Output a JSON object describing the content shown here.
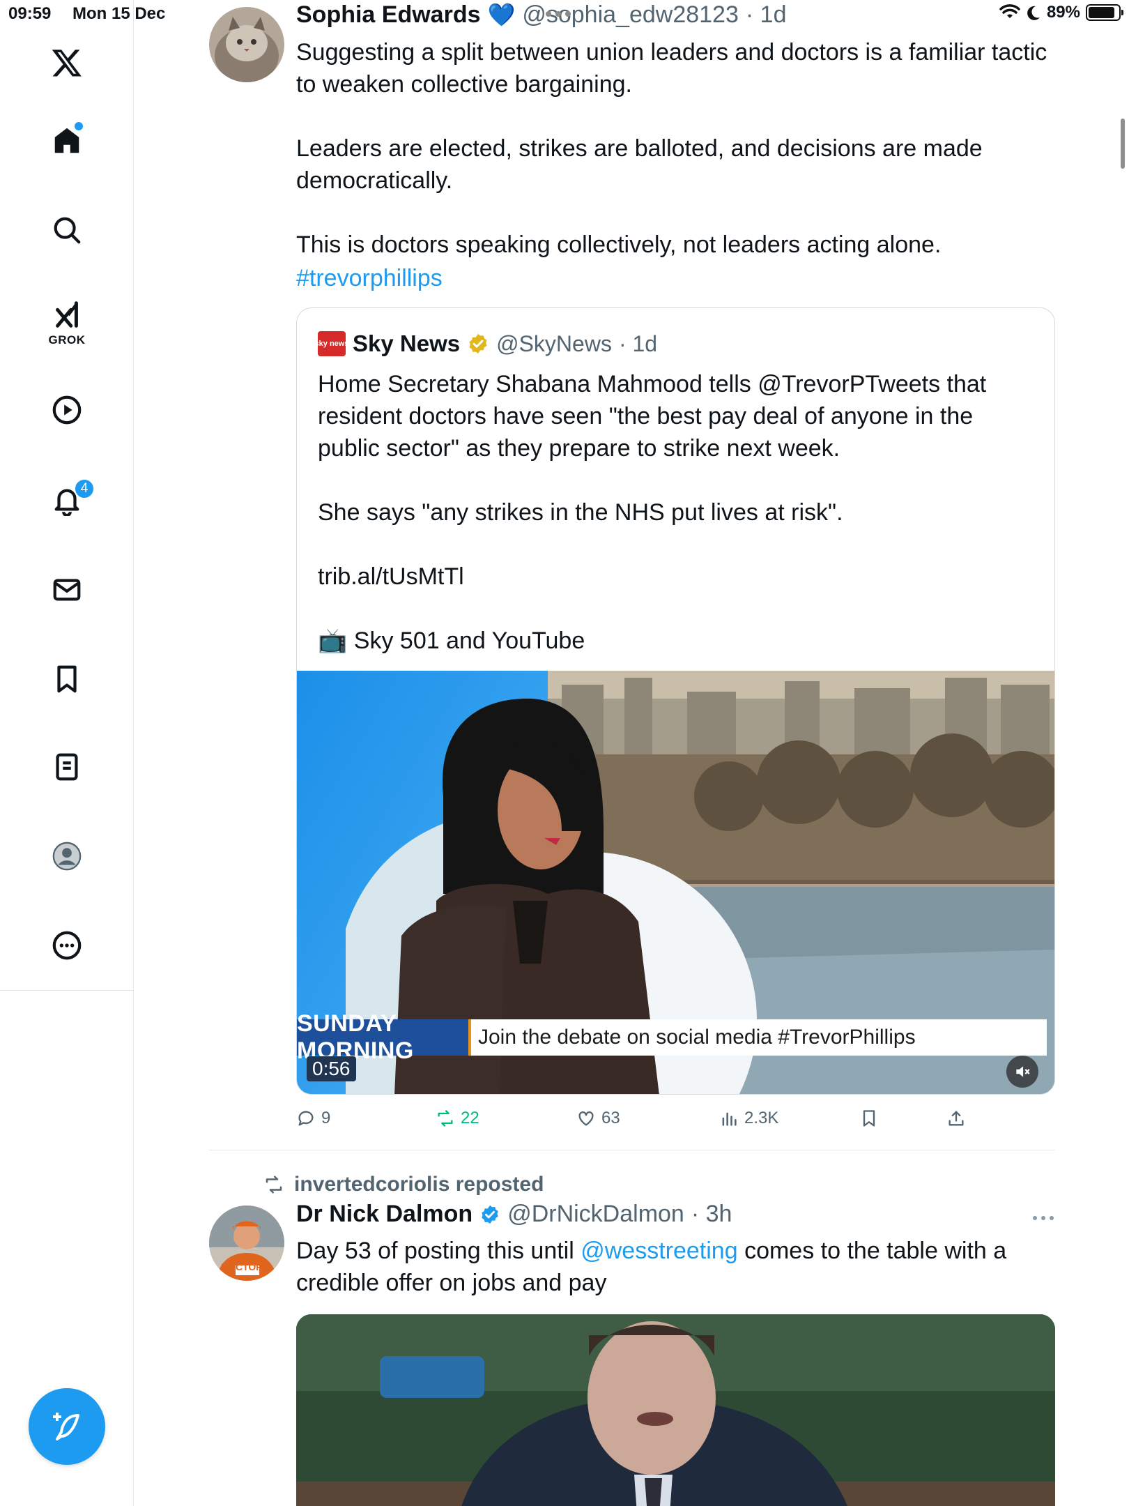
{
  "status_bar": {
    "time": "09:59",
    "date": "Mon 15 Dec",
    "battery": "89%",
    "battery_level": 0.89
  },
  "sidebar": {
    "grok_label": "GROK",
    "notification_count": "4"
  },
  "tweet1": {
    "name": "Sophia Edwards",
    "emoji": "💙",
    "handle": "@sophia_edw28123",
    "time": "· 1d",
    "text": "Suggesting a split between union leaders and doctors is a familiar tactic\nto weaken collective bargaining.\n\nLeaders are elected, strikes are balloted, and decisions are made\ndemocratically.\n\nThis is doctors speaking collectively, not leaders acting alone.",
    "hashtag": "#trevorphillips",
    "quote": {
      "logo_text": "sky news",
      "name": "Sky News",
      "handle": "@SkyNews",
      "time": "· 1d",
      "text": "Home Secretary Shabana Mahmood tells @TrevorPTweets that\nresident doctors have seen \"the best pay deal of anyone in the\npublic sector\" as they prepare to strike next week.\n\nShe says \"any strikes in the NHS put lives at risk\".\n\ntrib.al/tUsMtTl\n\n📺 Sky 501 and YouTube",
      "video": {
        "programme": "SUNDAY MORNING",
        "ticker": "Join the debate on social media #TrevorPhillips",
        "duration": "0:56"
      }
    },
    "actions": {
      "replies": "9",
      "reposts": "22",
      "likes": "63",
      "views": "2.3K"
    }
  },
  "tweet2": {
    "repost_label": "invertedcoriolis reposted",
    "name": "Dr Nick Dalmon",
    "handle": "@DrNickDalmon",
    "time": "· 3h",
    "text_before": "Day 53 of posting this until ",
    "mention": "@wesstreeting",
    "text_after": " comes to the table with a\ncredible offer on jobs and pay",
    "avatar_sign": "DOCTORS"
  },
  "colors": {
    "accent": "#1d9bf0",
    "repost_green": "#00ba7c",
    "secondary_text": "#536471",
    "verified_gold": "#e2b719"
  }
}
